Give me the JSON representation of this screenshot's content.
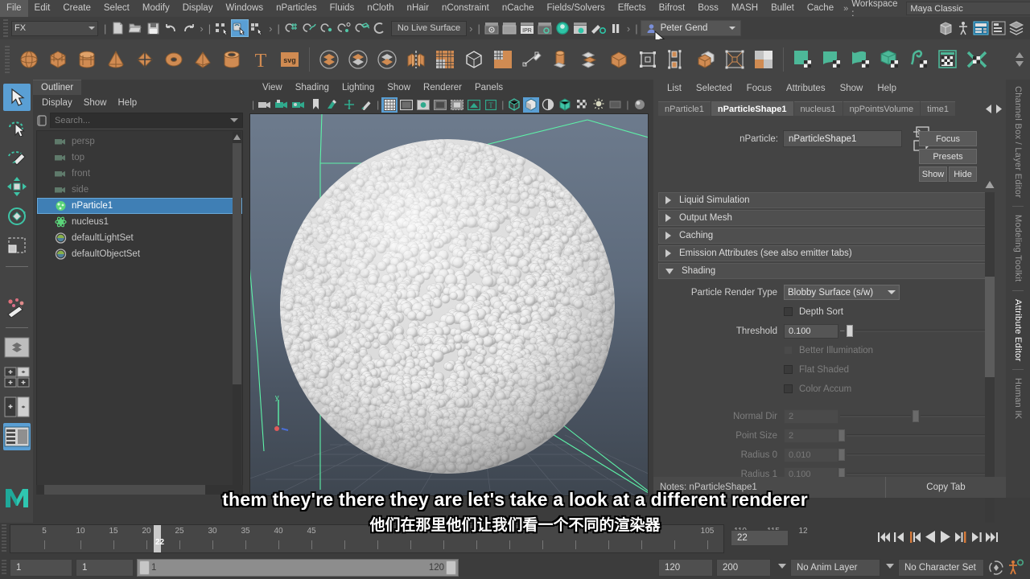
{
  "menubar": {
    "items": [
      "File",
      "Edit",
      "Create",
      "Select",
      "Modify",
      "Display",
      "Windows",
      "nParticles",
      "Fluids",
      "nCloth",
      "nHair",
      "nConstraint",
      "nCache",
      "Fields/Solvers",
      "Effects",
      "Bifrost",
      "Boss",
      "MASH",
      "Bullet",
      "Cache"
    ],
    "overflow_chevron": "»",
    "workspace_label": "Workspace :",
    "workspace_value": "Maya Classic"
  },
  "statusline": {
    "mode": "FX",
    "live_surface": "No Live Surface",
    "user": "Peter Gend",
    "icons": [
      "new-scene-icon",
      "open-scene-icon",
      "save-scene-icon",
      "undo-icon",
      "redo-icon",
      "select-by-hierarchy-icon",
      "select-by-object-icon",
      "select-by-component-icon",
      "snap-to-grid-icon",
      "snap-to-curve-icon",
      "snap-to-point-icon",
      "snap-to-projected-center-icon",
      "snap-to-view-plane-icon",
      "make-live-icon",
      "render-current-frame-icon",
      "open-render-view-icon",
      "ipr-render-icon",
      "render-settings-icon",
      "hypershade-icon",
      "render-setup-icon",
      "rendering-flags-icon",
      "pause-render-icon",
      "user-avatar-icon",
      "open-channel-box-icon",
      "open-anim-layers-icon",
      "open-attribute-editor-icon",
      "open-tool-settings-icon",
      "open-layer-editor-icon"
    ]
  },
  "outliner": {
    "title": "Outliner",
    "menus": [
      "Display",
      "Show",
      "Help"
    ],
    "search_placeholder": "Search...",
    "items": [
      {
        "label": "persp",
        "icon": "camera-icon",
        "state": "dim"
      },
      {
        "label": "top",
        "icon": "camera-icon",
        "state": "dim"
      },
      {
        "label": "front",
        "icon": "camera-icon",
        "state": "dim"
      },
      {
        "label": "side",
        "icon": "camera-icon",
        "state": "dim"
      },
      {
        "label": "nParticle1",
        "icon": "nparticle-icon",
        "state": "selected"
      },
      {
        "label": "nucleus1",
        "icon": "nucleus-icon",
        "state": "normal"
      },
      {
        "label": "defaultLightSet",
        "icon": "set-icon",
        "state": "normal"
      },
      {
        "label": "defaultObjectSet",
        "icon": "set-icon",
        "state": "normal"
      }
    ]
  },
  "viewport": {
    "menus": [
      "View",
      "Shading",
      "Lighting",
      "Show",
      "Renderer",
      "Panels"
    ],
    "toolbar_icons": [
      "select-camera-icon",
      "lock-camera-icon",
      "camera-attributes-icon",
      "bookmark-icon",
      "image-plane-icon",
      "two-d-pan-zoom-icon",
      "grease-pencil-icon",
      "grid-toggle-icon",
      "film-gate-icon",
      "resolution-gate-icon",
      "gate-mask-icon",
      "film-origin-icon",
      "exposure-icon",
      "xray-icon",
      "wireframe-shaded-icon",
      "smooth-shade-all-icon",
      "smooth-shade-selected-icon",
      "flat-shade-icon",
      "wireframe-on-shaded-icon",
      "texture-toggle-icon",
      "lights-toggle-icon",
      "shadows-icon",
      "screen-space-ao-icon"
    ]
  },
  "attribute_editor": {
    "menus": [
      "List",
      "Selected",
      "Focus",
      "Attributes",
      "Show",
      "Help"
    ],
    "tabs": [
      "nParticle1",
      "nParticleShape1",
      "nucleus1",
      "npPointsVolume",
      "time1"
    ],
    "active_tab": "nParticleShape1",
    "node_label": "nParticle:",
    "node_value": "nParticleShape1",
    "buttons": {
      "focus": "Focus",
      "presets": "Presets",
      "show": "Show",
      "hide": "Hide"
    },
    "frames": [
      {
        "label": "Liquid Simulation",
        "expanded": false
      },
      {
        "label": "Output Mesh",
        "expanded": false
      },
      {
        "label": "Caching",
        "expanded": false
      },
      {
        "label": "Emission Attributes (see also emitter tabs)",
        "expanded": false
      },
      {
        "label": "Shading",
        "expanded": true
      }
    ],
    "shading": {
      "render_type_label": "Particle Render Type",
      "render_type_value": "Blobby Surface (s/w)",
      "depth_sort_label": "Depth Sort",
      "threshold_label": "Threshold",
      "threshold_value": "0.100",
      "better_illumination_label": "Better Illumination",
      "flat_shaded_label": "Flat Shaded",
      "color_accum_label": "Color Accum",
      "normal_dir_label": "Normal Dir",
      "normal_dir_value": "2",
      "point_size_label": "Point Size",
      "point_size_value": "2",
      "radius0_label": "Radius 0",
      "radius0_value": "0.010",
      "radius1_label": "Radius 1",
      "radius1_value": "0.100"
    },
    "bottom": {
      "notes": "Notes: nParticleShape1",
      "copy_tab": "Copy Tab"
    }
  },
  "right_tabs": {
    "items": [
      "Channel Box / Layer Editor",
      "Modeling Toolkit",
      "Attribute Editor",
      "Human IK"
    ],
    "active": "Attribute Editor"
  },
  "timeline": {
    "tick_labels": [
      "5",
      "10",
      "15",
      "20",
      "25",
      "30",
      "35",
      "40",
      "45",
      "105",
      "110",
      "115",
      "12"
    ],
    "current_frame_marker": "22",
    "current_frame_field": "22",
    "playback_buttons": [
      "go-to-start-icon",
      "step-back-key-icon",
      "step-back-frame-icon",
      "play-backwards-icon",
      "play-forwards-icon",
      "step-forward-frame-icon",
      "step-forward-key-icon",
      "go-to-end-icon"
    ]
  },
  "range_slider": {
    "anim_start": "1",
    "range_start": "1",
    "slider_start_label": "1",
    "slider_end_label": "120",
    "range_end": "120",
    "anim_end": "200",
    "anim_layer": "No Anim Layer",
    "character_set": "No Character Set",
    "auto_key_icon": "auto-key-icon",
    "anim_prefs_icon": "animation-preferences-icon"
  },
  "toolbox": {
    "items": [
      "select-tool",
      "lasso-select-tool",
      "paint-select-tool",
      "move-tool",
      "rotate-tool",
      "scale-tool",
      "last-tool-used",
      "single-perspective-layout",
      "four-view-layout",
      "two-pane-layout",
      "outliner-persp-layout"
    ],
    "logo": "maya-logo"
  },
  "subtitles": {
    "english": "them they're there they are let's take a look at a different renderer",
    "chinese": "他们在那里他们让我们看一个不同的渲染器"
  },
  "colors": {
    "accent_blue": "#5a9fd4",
    "selection_blue": "#3f7fb5",
    "shelf_orange": "#d08b52",
    "shelf_green": "#4db898",
    "nucleus_green": "#5bf0a5",
    "panel_bg": "#444444"
  }
}
